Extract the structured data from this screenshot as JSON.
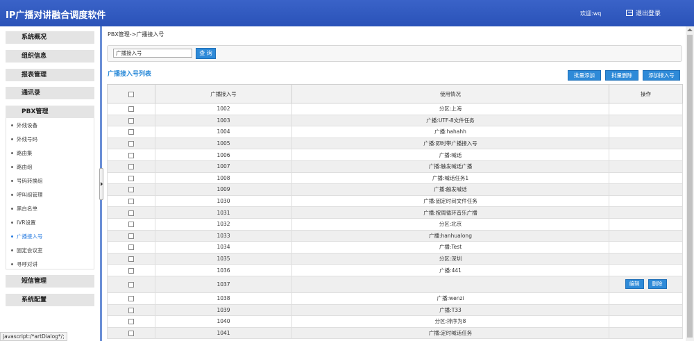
{
  "header": {
    "app_title": "IP广播对讲融合调度软件",
    "welcome": "欢迎:wq",
    "logout": "退出登录"
  },
  "sidebar": {
    "sections": [
      "系统概况",
      "组织信息",
      "报表管理",
      "通讯录",
      "PBX管理",
      "短信管理",
      "系统配置"
    ],
    "pbx_items": [
      "外线设备",
      "外线号码",
      "路由集",
      "路由组",
      "号码转换组",
      "呼叫组管理",
      "黑白名单",
      "IVR设置",
      "广播接入号",
      "固定会议室",
      "寻呼对讲"
    ],
    "active_item": "广播接入号"
  },
  "main": {
    "breadcrumb": "PBX管理->广播接入号",
    "search": {
      "value": "广播接入号",
      "button": "查 询"
    },
    "list_title": "广播接入号列表",
    "buttons": {
      "batch_add": "批量添加",
      "batch_delete": "批量删除",
      "add": "添加接入号"
    },
    "columns": [
      "广播接入号",
      "使用情况",
      "操作"
    ],
    "ops": {
      "edit": "编辑",
      "delete": "删除"
    },
    "rows": [
      {
        "num": "1002",
        "usage": "分区:上海"
      },
      {
        "num": "1003",
        "usage": "广播:UTF-8文件任务"
      },
      {
        "num": "1004",
        "usage": "广播:hahahh"
      },
      {
        "num": "1005",
        "usage": "广播:即时带广播接入号"
      },
      {
        "num": "1006",
        "usage": "广播:喊话"
      },
      {
        "num": "1007",
        "usage": "广播:触发喊话广播"
      },
      {
        "num": "1008",
        "usage": "广播:喊话任务1"
      },
      {
        "num": "1009",
        "usage": "广播:触发喊话"
      },
      {
        "num": "1030",
        "usage": "广播:固定时间文件任务"
      },
      {
        "num": "1031",
        "usage": "广播:按周循环音乐广播"
      },
      {
        "num": "1032",
        "usage": "分区:北京"
      },
      {
        "num": "1033",
        "usage": "广播:hanhualong"
      },
      {
        "num": "1034",
        "usage": "广播:Test"
      },
      {
        "num": "1035",
        "usage": "分区:深圳"
      },
      {
        "num": "1036",
        "usage": "广播:441"
      },
      {
        "num": "1037",
        "usage": "",
        "has_ops": true
      },
      {
        "num": "1038",
        "usage": "广播:wenzi"
      },
      {
        "num": "1039",
        "usage": "广播:T33"
      },
      {
        "num": "1040",
        "usage": "分区:排序为8"
      },
      {
        "num": "1041",
        "usage": "广播:定时喊话任务"
      }
    ]
  },
  "status_bar": "javascript:/*artDialog*/;"
}
